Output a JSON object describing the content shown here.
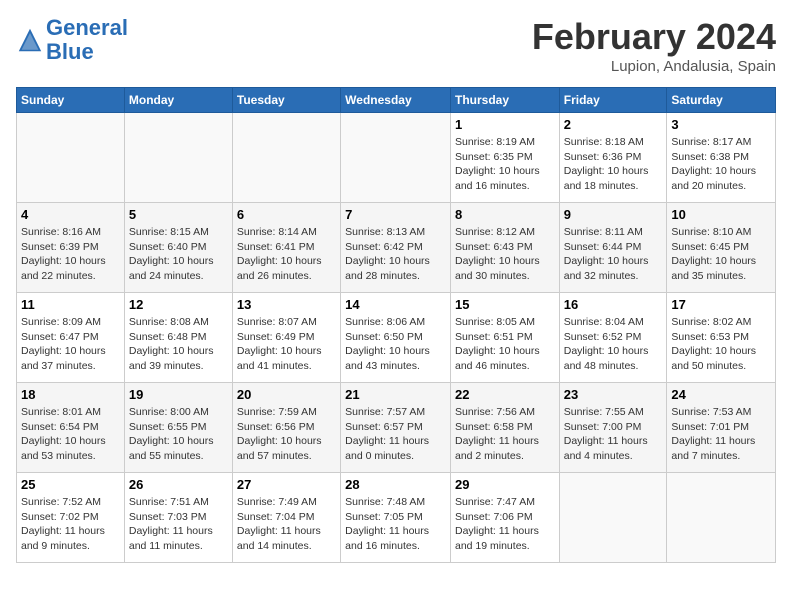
{
  "header": {
    "logo_line1": "General",
    "logo_line2": "Blue",
    "month_year": "February 2024",
    "location": "Lupion, Andalusia, Spain"
  },
  "weekdays": [
    "Sunday",
    "Monday",
    "Tuesday",
    "Wednesday",
    "Thursday",
    "Friday",
    "Saturday"
  ],
  "weeks": [
    [
      {
        "day": "",
        "info": ""
      },
      {
        "day": "",
        "info": ""
      },
      {
        "day": "",
        "info": ""
      },
      {
        "day": "",
        "info": ""
      },
      {
        "day": "1",
        "info": "Sunrise: 8:19 AM\nSunset: 6:35 PM\nDaylight: 10 hours\nand 16 minutes."
      },
      {
        "day": "2",
        "info": "Sunrise: 8:18 AM\nSunset: 6:36 PM\nDaylight: 10 hours\nand 18 minutes."
      },
      {
        "day": "3",
        "info": "Sunrise: 8:17 AM\nSunset: 6:38 PM\nDaylight: 10 hours\nand 20 minutes."
      }
    ],
    [
      {
        "day": "4",
        "info": "Sunrise: 8:16 AM\nSunset: 6:39 PM\nDaylight: 10 hours\nand 22 minutes."
      },
      {
        "day": "5",
        "info": "Sunrise: 8:15 AM\nSunset: 6:40 PM\nDaylight: 10 hours\nand 24 minutes."
      },
      {
        "day": "6",
        "info": "Sunrise: 8:14 AM\nSunset: 6:41 PM\nDaylight: 10 hours\nand 26 minutes."
      },
      {
        "day": "7",
        "info": "Sunrise: 8:13 AM\nSunset: 6:42 PM\nDaylight: 10 hours\nand 28 minutes."
      },
      {
        "day": "8",
        "info": "Sunrise: 8:12 AM\nSunset: 6:43 PM\nDaylight: 10 hours\nand 30 minutes."
      },
      {
        "day": "9",
        "info": "Sunrise: 8:11 AM\nSunset: 6:44 PM\nDaylight: 10 hours\nand 32 minutes."
      },
      {
        "day": "10",
        "info": "Sunrise: 8:10 AM\nSunset: 6:45 PM\nDaylight: 10 hours\nand 35 minutes."
      }
    ],
    [
      {
        "day": "11",
        "info": "Sunrise: 8:09 AM\nSunset: 6:47 PM\nDaylight: 10 hours\nand 37 minutes."
      },
      {
        "day": "12",
        "info": "Sunrise: 8:08 AM\nSunset: 6:48 PM\nDaylight: 10 hours\nand 39 minutes."
      },
      {
        "day": "13",
        "info": "Sunrise: 8:07 AM\nSunset: 6:49 PM\nDaylight: 10 hours\nand 41 minutes."
      },
      {
        "day": "14",
        "info": "Sunrise: 8:06 AM\nSunset: 6:50 PM\nDaylight: 10 hours\nand 43 minutes."
      },
      {
        "day": "15",
        "info": "Sunrise: 8:05 AM\nSunset: 6:51 PM\nDaylight: 10 hours\nand 46 minutes."
      },
      {
        "day": "16",
        "info": "Sunrise: 8:04 AM\nSunset: 6:52 PM\nDaylight: 10 hours\nand 48 minutes."
      },
      {
        "day": "17",
        "info": "Sunrise: 8:02 AM\nSunset: 6:53 PM\nDaylight: 10 hours\nand 50 minutes."
      }
    ],
    [
      {
        "day": "18",
        "info": "Sunrise: 8:01 AM\nSunset: 6:54 PM\nDaylight: 10 hours\nand 53 minutes."
      },
      {
        "day": "19",
        "info": "Sunrise: 8:00 AM\nSunset: 6:55 PM\nDaylight: 10 hours\nand 55 minutes."
      },
      {
        "day": "20",
        "info": "Sunrise: 7:59 AM\nSunset: 6:56 PM\nDaylight: 10 hours\nand 57 minutes."
      },
      {
        "day": "21",
        "info": "Sunrise: 7:57 AM\nSunset: 6:57 PM\nDaylight: 11 hours\nand 0 minutes."
      },
      {
        "day": "22",
        "info": "Sunrise: 7:56 AM\nSunset: 6:58 PM\nDaylight: 11 hours\nand 2 minutes."
      },
      {
        "day": "23",
        "info": "Sunrise: 7:55 AM\nSunset: 7:00 PM\nDaylight: 11 hours\nand 4 minutes."
      },
      {
        "day": "24",
        "info": "Sunrise: 7:53 AM\nSunset: 7:01 PM\nDaylight: 11 hours\nand 7 minutes."
      }
    ],
    [
      {
        "day": "25",
        "info": "Sunrise: 7:52 AM\nSunset: 7:02 PM\nDaylight: 11 hours\nand 9 minutes."
      },
      {
        "day": "26",
        "info": "Sunrise: 7:51 AM\nSunset: 7:03 PM\nDaylight: 11 hours\nand 11 minutes."
      },
      {
        "day": "27",
        "info": "Sunrise: 7:49 AM\nSunset: 7:04 PM\nDaylight: 11 hours\nand 14 minutes."
      },
      {
        "day": "28",
        "info": "Sunrise: 7:48 AM\nSunset: 7:05 PM\nDaylight: 11 hours\nand 16 minutes."
      },
      {
        "day": "29",
        "info": "Sunrise: 7:47 AM\nSunset: 7:06 PM\nDaylight: 11 hours\nand 19 minutes."
      },
      {
        "day": "",
        "info": ""
      },
      {
        "day": "",
        "info": ""
      }
    ]
  ]
}
